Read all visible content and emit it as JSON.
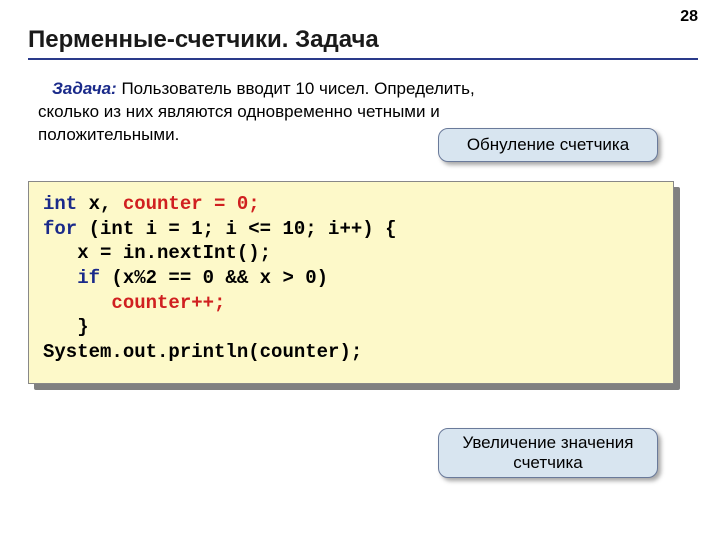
{
  "page_number": "28",
  "title": "Перменные-счетчики. Задача",
  "task": {
    "label": "Задача:",
    "text_line1": " Пользователь вводит 10 чисел. Определить,",
    "text_line2": "сколько из них являются одновременно четными и",
    "text_line3": "положительными."
  },
  "callouts": {
    "reset": "Обнуление счетчика",
    "increment": "Увеличение значения счетчика"
  },
  "code": {
    "int": "int",
    "xdecl": " x, ",
    "counter_init": "counter = 0;",
    "for": "for",
    "for_head": " (int i = 1; i <= 10; i++) {",
    "l3": "   x = in.nextInt();",
    "if": "   if",
    "cond": " (x%2 == 0 && x > 0)",
    "cpp_indent": "      ",
    "cpp": "counter++;",
    "close": "   }",
    "print": "System.out.println(counter);"
  }
}
